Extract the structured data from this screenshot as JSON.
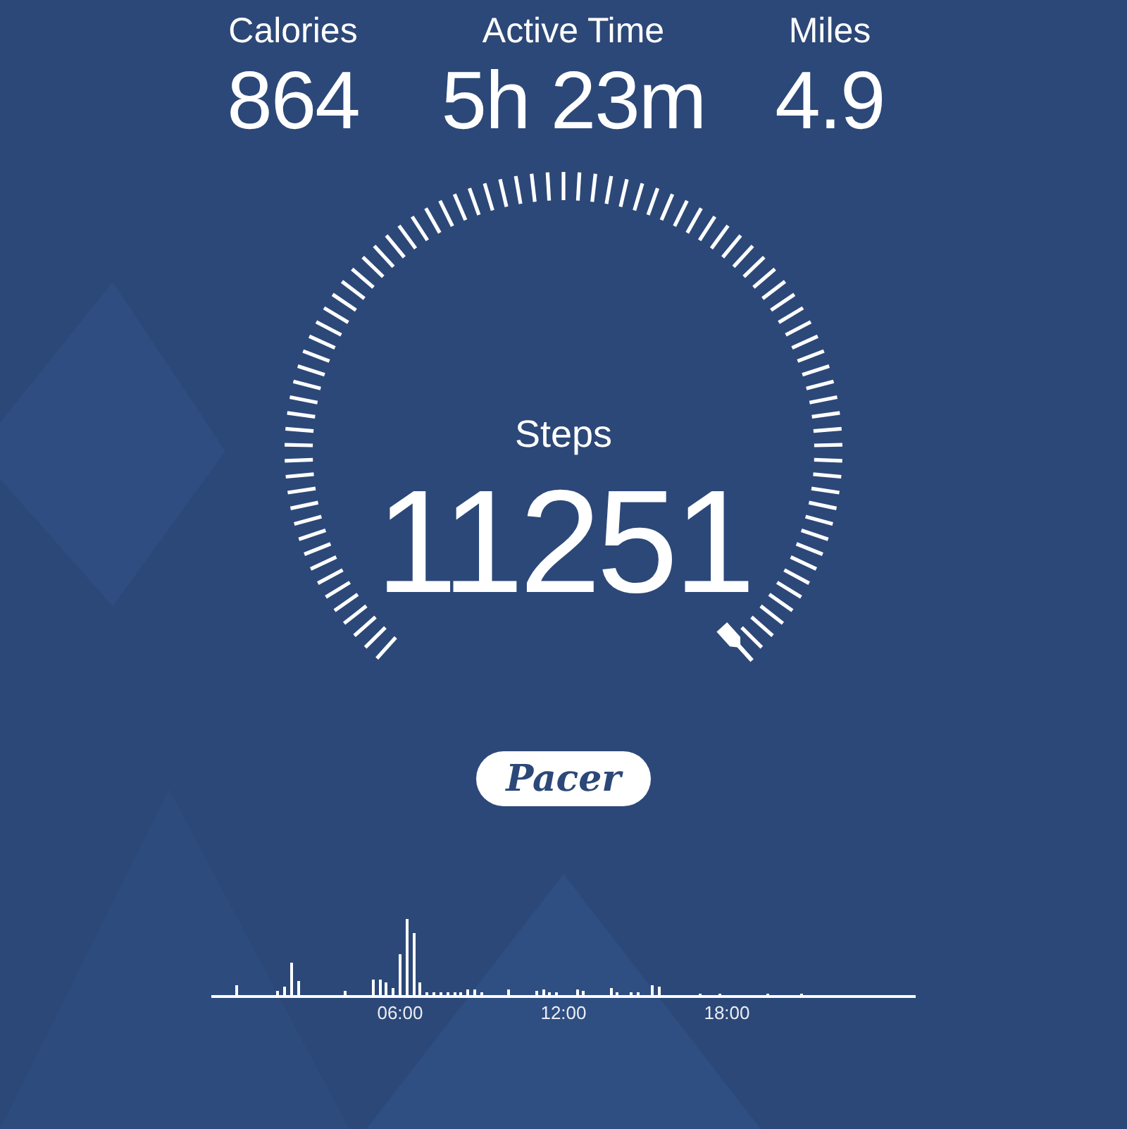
{
  "stats": [
    {
      "label": "Calories",
      "value": "864"
    },
    {
      "label": "Active Time",
      "value": "5h 23m"
    },
    {
      "label": "Miles",
      "value": "4.9"
    }
  ],
  "gauge": {
    "label": "Steps",
    "value": "11251"
  },
  "brand": "Pacer",
  "activity_chart": {
    "x_labels": [
      "06:00",
      "12:00",
      "18:00"
    ]
  }
}
